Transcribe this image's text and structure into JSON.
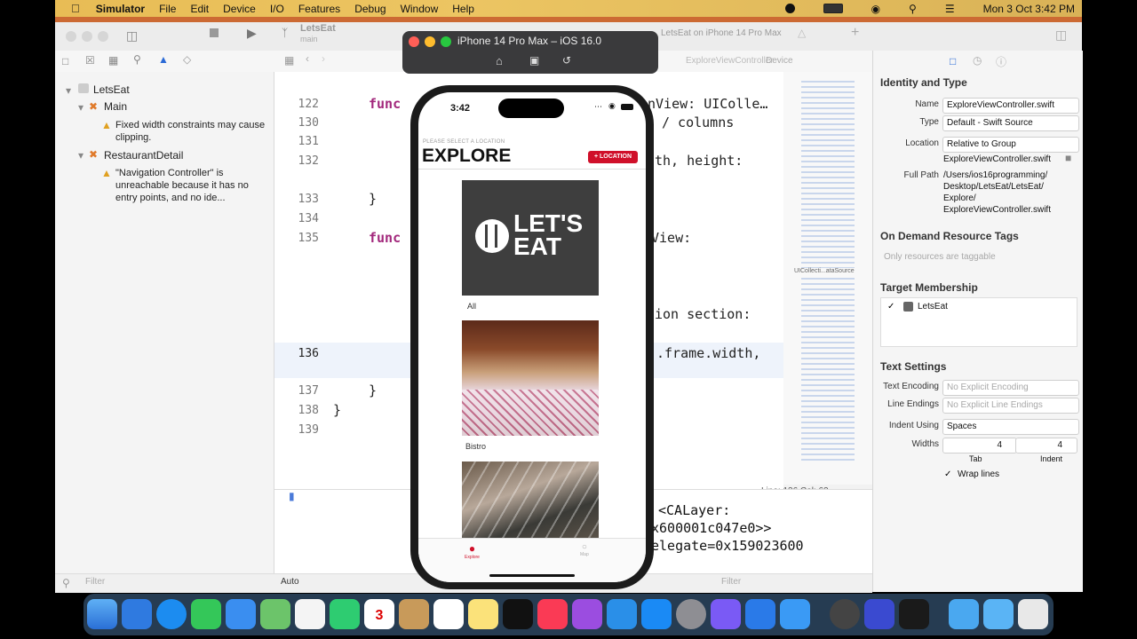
{
  "menubar": {
    "app": "Simulator",
    "items": [
      "File",
      "Edit",
      "Device",
      "I/O",
      "Features",
      "Debug",
      "Window",
      "Help"
    ],
    "clock": "Mon 3 Oct  3:42 PM"
  },
  "toolbar": {
    "project": "LetsEat",
    "branch": "main",
    "scheme_target": "LetsEat on iPhone 14 Pro Max"
  },
  "jumpbar": {
    "file_tab": "ExploreViewController",
    "device": "Device"
  },
  "navigator": {
    "project": "LetsEat",
    "group_main": "Main",
    "warning1": "Fixed width constraints may cause clipping.",
    "group_detail": "RestaurantDetail",
    "warning2": "\"Navigation Controller\" is unreachable because it has no entry points, and no ide...",
    "filter_placeholder": "Filter"
  },
  "editor": {
    "lines": [
      {
        "n": "122",
        "code": "func",
        "rest": "nView: UIColle…"
      },
      {
        "n": "130",
        "code": "",
        "rest": "/ columns"
      },
      {
        "n": "131",
        "code": "",
        "rest": ""
      },
      {
        "n": "132",
        "code": "",
        "rest": "th, height:"
      },
      {
        "n": "133",
        "code": "}",
        "rest": ""
      },
      {
        "n": "134",
        "code": "",
        "rest": ""
      },
      {
        "n": "135",
        "code": "func",
        "rest": "View:"
      },
      {
        "n": "136",
        "code": "",
        "rest": "ion section:"
      },
      {
        "n": "136",
        "code": "",
        "rest": ".frame.width,"
      },
      {
        "n": "137",
        "code": "}",
        "rest": ""
      },
      {
        "n": "138",
        "code": "}",
        "rest": ""
      },
      {
        "n": "139",
        "code": "",
        "rest": ""
      }
    ],
    "status": "Line: 136  Col: 62",
    "minimap_label": "UICollecti...ataSource"
  },
  "debug": {
    "line1": "<CALayer:",
    "line2": "x600001c047e0>>",
    "line3": "elegate=0x159023600",
    "auto_label": "Auto",
    "filter_placeholder": "Filter"
  },
  "inspector": {
    "identity_type": "Identity and Type",
    "name_label": "Name",
    "name_value": "ExploreViewController.swift",
    "type_label": "Type",
    "type_value": "Default - Swift Source",
    "location_label": "Location",
    "location_value": "Relative to Group",
    "location_file": "ExploreViewController.swift",
    "fullpath_label": "Full Path",
    "fullpath_value": "/Users/ios16programming/ Desktop/LetsEat/LetsEat/ Explore/ ExploreViewController.swift",
    "on_demand": "On Demand Resource Tags",
    "tags_placeholder": "Only resources are taggable",
    "target_membership": "Target Membership",
    "target": "LetsEat",
    "text_settings": "Text Settings",
    "text_encoding_label": "Text Encoding",
    "text_encoding_value": "No Explicit Encoding",
    "line_endings_label": "Line Endings",
    "line_endings_value": "No Explicit Line Endings",
    "indent_using_label": "Indent Using",
    "indent_using_value": "Spaces",
    "widths_label": "Widths",
    "tab_value": "4",
    "indent_value": "4",
    "tab_label": "Tab",
    "indent_label": "Indent",
    "wrap_lines": "Wrap lines"
  },
  "simulator": {
    "title": "iPhone 14 Pro Max – iOS 16.0",
    "time": "3:42",
    "subtitle": "PLEASE SELECT A LOCATION",
    "heading": "EXPLORE",
    "location_button": "LOCATION",
    "logo_line1": "LET'S",
    "logo_line2": "EAT",
    "cells": [
      "All",
      "Bistro"
    ],
    "tab_explore": "Explore",
    "tab_map": "Map"
  },
  "colors": {
    "accent_red": "#d0102a",
    "keyword": "#a2287c",
    "desktop": "#cc6a33"
  }
}
